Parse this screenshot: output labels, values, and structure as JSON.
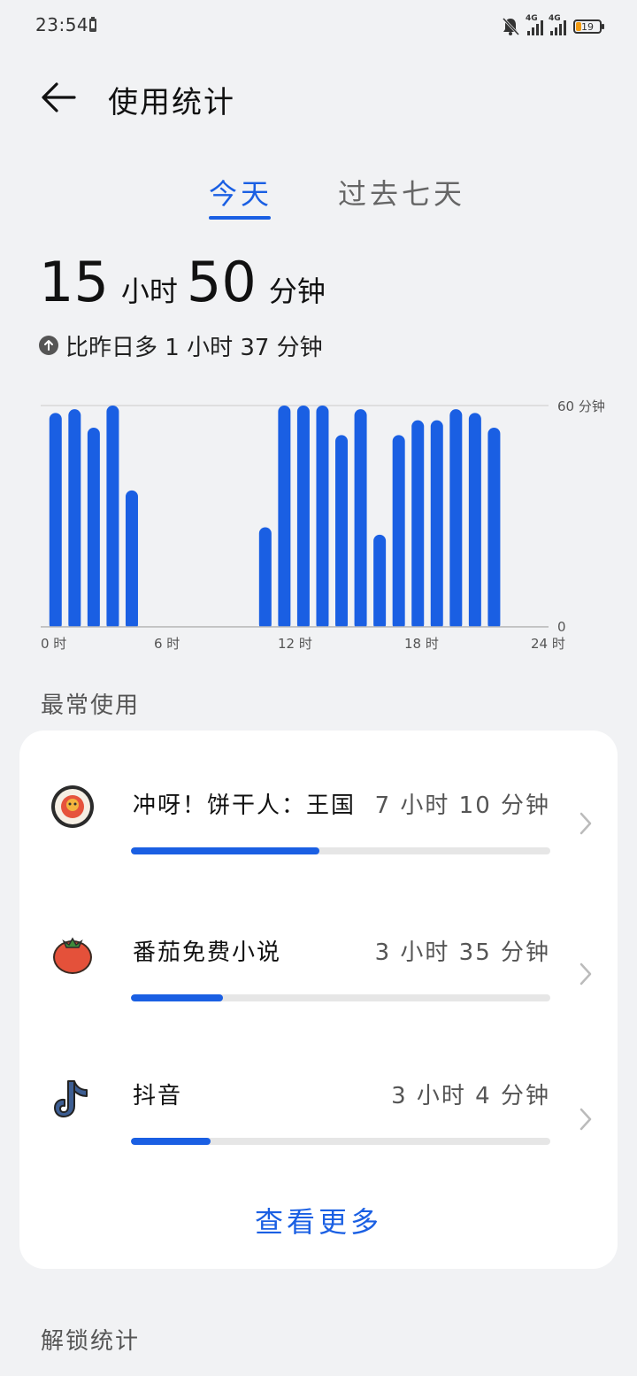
{
  "status": {
    "time": "23:54",
    "net1": "4G",
    "net2": "4G",
    "battery": "19"
  },
  "header": {
    "title": "使用统计"
  },
  "tabs": [
    {
      "label": "今天"
    },
    {
      "label": "过去七天"
    }
  ],
  "summary": {
    "hours": "15",
    "hours_unit": "小时",
    "minutes": "50",
    "minutes_unit": "分钟",
    "compare": "比昨日多 1 小时 37 分钟"
  },
  "chart_data": {
    "type": "bar",
    "x_tick_labels": [
      "0 时",
      "6 时",
      "12 时",
      "18 时",
      "24 时"
    ],
    "y_tick_labels": [
      "60 分钟",
      "0"
    ],
    "ylim": [
      0,
      60
    ],
    "x": [
      0,
      1,
      2,
      3,
      4,
      5,
      6,
      7,
      8,
      9,
      10,
      11,
      12,
      13,
      14,
      15,
      16,
      17,
      18,
      19,
      20,
      21,
      22,
      23
    ],
    "values": [
      58,
      59,
      54,
      60,
      37,
      0,
      0,
      0,
      0,
      0,
      0,
      27,
      60,
      60,
      60,
      52,
      59,
      25,
      52,
      56,
      56,
      59,
      58,
      54
    ],
    "color": "#1a5fe3",
    "grid": true
  },
  "most_used": {
    "label": "最常使用",
    "apps": [
      {
        "name": "冲呀！饼干人：王国",
        "time": "7 小时 10 分钟",
        "fraction": 0.45,
        "icon": "cookie-kingdom-icon"
      },
      {
        "name": "番茄免费小说",
        "time": "3 小时 35 分钟",
        "fraction": 0.22,
        "icon": "tomato-icon"
      },
      {
        "name": "抖音",
        "time": "3 小时 4 分钟",
        "fraction": 0.19,
        "icon": "douyin-icon"
      }
    ],
    "see_more": "查看更多"
  },
  "unlock": {
    "label": "解锁统计"
  },
  "colors": {
    "accent": "#1a5fe3",
    "background": "#f1f2f4"
  }
}
